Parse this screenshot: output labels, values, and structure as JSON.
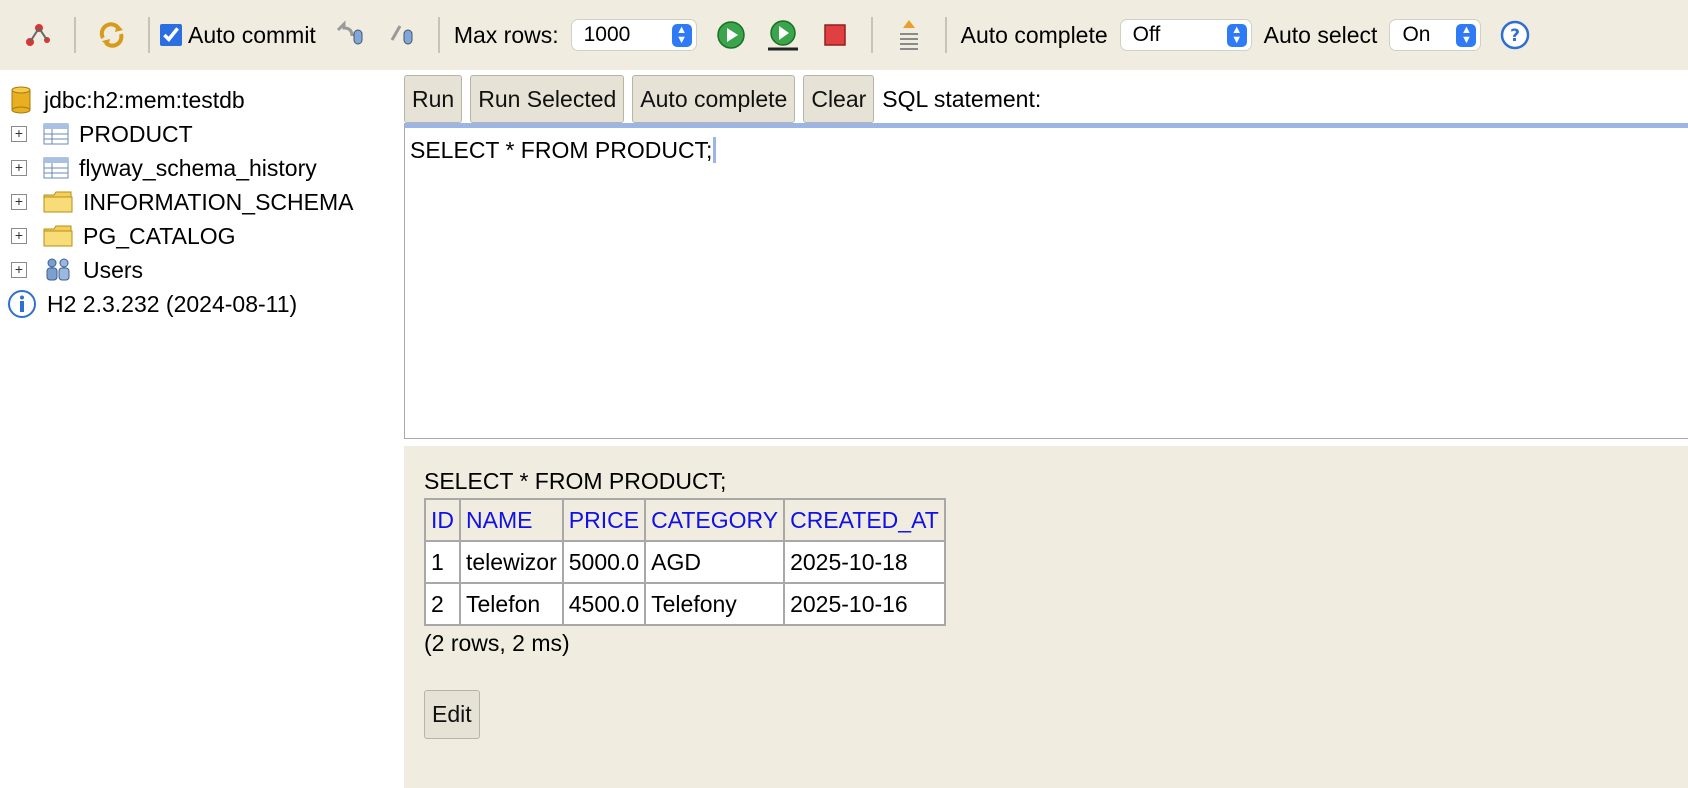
{
  "toolbar": {
    "auto_commit_label": "Auto commit",
    "auto_commit_checked": true,
    "max_rows_label": "Max rows:",
    "max_rows_value": "1000",
    "auto_complete_label": "Auto complete",
    "auto_complete_value": "Off",
    "auto_select_label": "Auto select",
    "auto_select_value": "On",
    "icons": [
      "disconnect-icon",
      "refresh-icon",
      "rollback-icon",
      "commit-icon",
      "run-icon",
      "run-selected-icon",
      "stop-icon",
      "history-icon",
      "help-icon"
    ]
  },
  "tree": {
    "connection": "jdbc:h2:mem:testdb",
    "items": [
      {
        "label": "PRODUCT",
        "icon": "table-icon"
      },
      {
        "label": "flyway_schema_history",
        "icon": "table-icon"
      },
      {
        "label": "INFORMATION_SCHEMA",
        "icon": "folder-icon"
      },
      {
        "label": "PG_CATALOG",
        "icon": "folder-icon"
      },
      {
        "label": "Users",
        "icon": "users-icon"
      }
    ],
    "version": "H2 2.3.232 (2024-08-11)"
  },
  "query": {
    "run_label": "Run",
    "run_selected_label": "Run Selected",
    "auto_complete_label": "Auto complete",
    "clear_label": "Clear",
    "sql_statement_label": "SQL statement:",
    "sql_text": "SELECT * FROM PRODUCT;"
  },
  "results": {
    "sql_echo": "SELECT * FROM PRODUCT;",
    "columns": [
      "ID",
      "NAME",
      "PRICE",
      "CATEGORY",
      "CREATED_AT"
    ],
    "rows": [
      [
        "1",
        "telewizor",
        "5000.0",
        "AGD",
        "2025-10-18"
      ],
      [
        "2",
        "Telefon",
        "4500.0",
        "Telefony",
        "2025-10-16"
      ]
    ],
    "row_count": "(2 rows, 2 ms)",
    "edit_label": "Edit"
  },
  "colors": {
    "toolbar_bg": "#f0ede0",
    "header_link": "#1010e8",
    "accent": "#2f7bf5"
  }
}
